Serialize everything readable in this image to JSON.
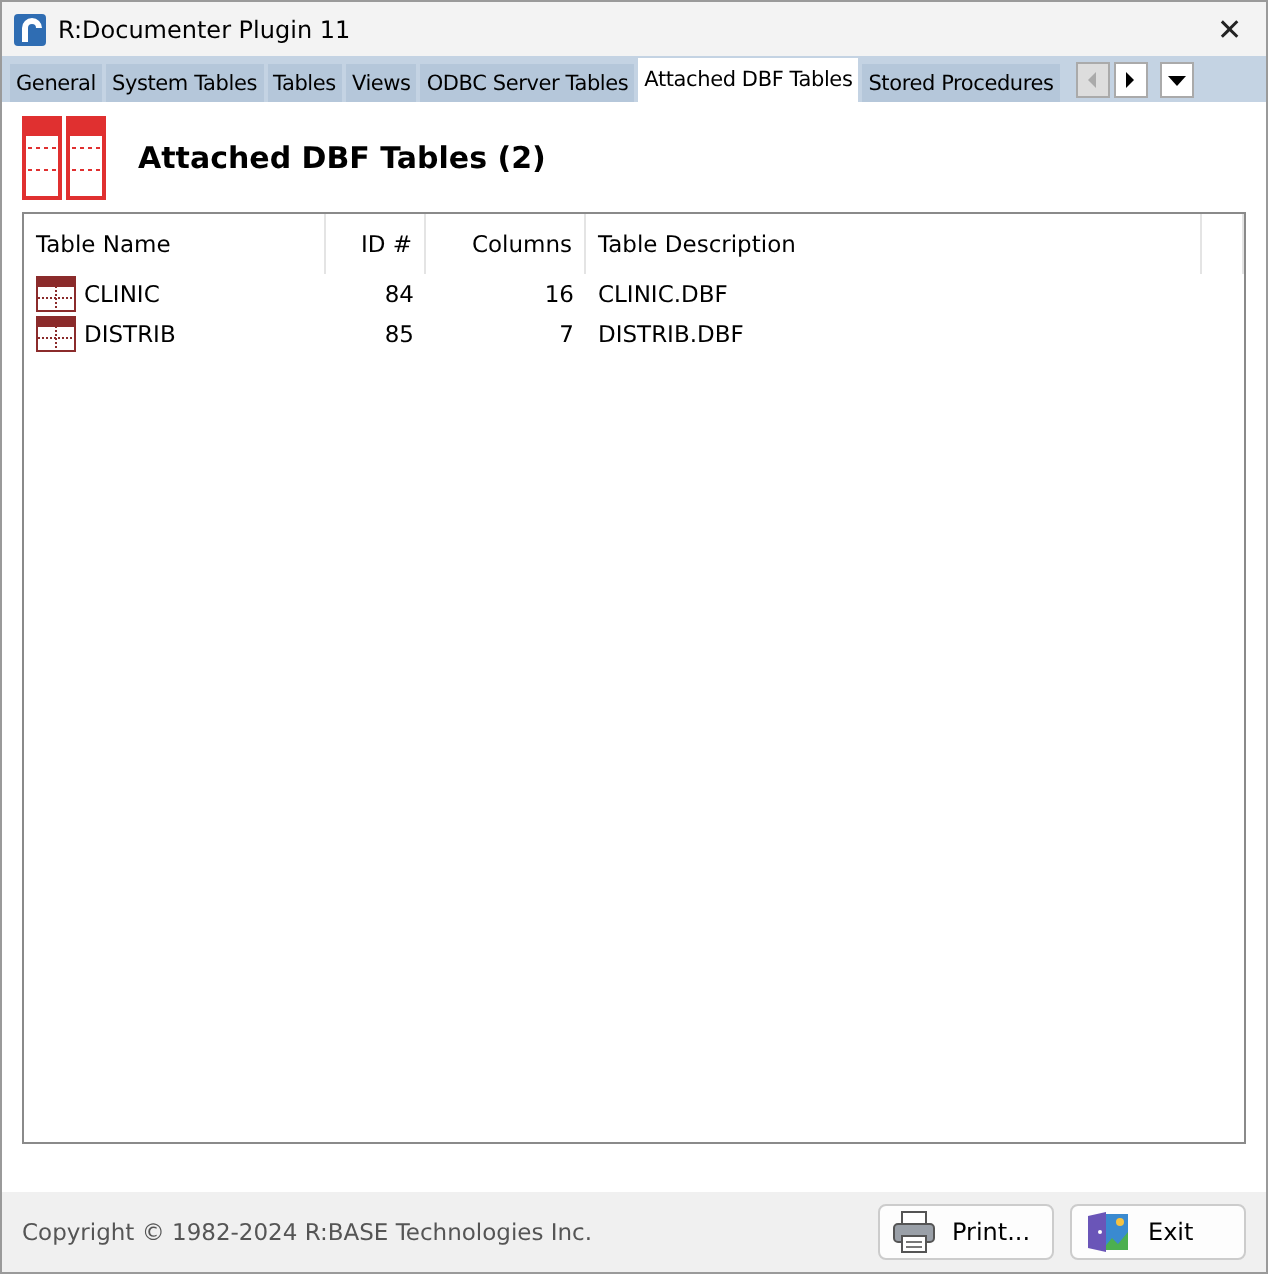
{
  "window": {
    "title": "R:Documenter Plugin 11",
    "close": "✕"
  },
  "tabs": [
    {
      "label": "General",
      "selected": false
    },
    {
      "label": "System Tables",
      "selected": false
    },
    {
      "label": "Tables",
      "selected": false
    },
    {
      "label": "Views",
      "selected": false
    },
    {
      "label": "ODBC Server Tables",
      "selected": false
    },
    {
      "label": "Attached DBF Tables",
      "selected": true
    },
    {
      "label": "Stored Procedures",
      "selected": false
    }
  ],
  "heading": "Attached DBF Tables (2)",
  "table": {
    "columns": [
      "Table Name",
      "ID #",
      "Columns",
      "Table Description"
    ],
    "rows": [
      {
        "cells": [
          "CLINIC",
          "84",
          "16",
          "CLINIC.DBF"
        ]
      },
      {
        "cells": [
          "DISTRIB",
          "85",
          "7",
          "DISTRIB.DBF"
        ]
      }
    ]
  },
  "status_bar": {
    "copyright": "Copyright © 1982-2024 R:BASE Technologies Inc.",
    "buttons": [
      {
        "label": "Print...",
        "kind": "print"
      },
      {
        "label": "Exit",
        "kind": "exit"
      }
    ]
  }
}
